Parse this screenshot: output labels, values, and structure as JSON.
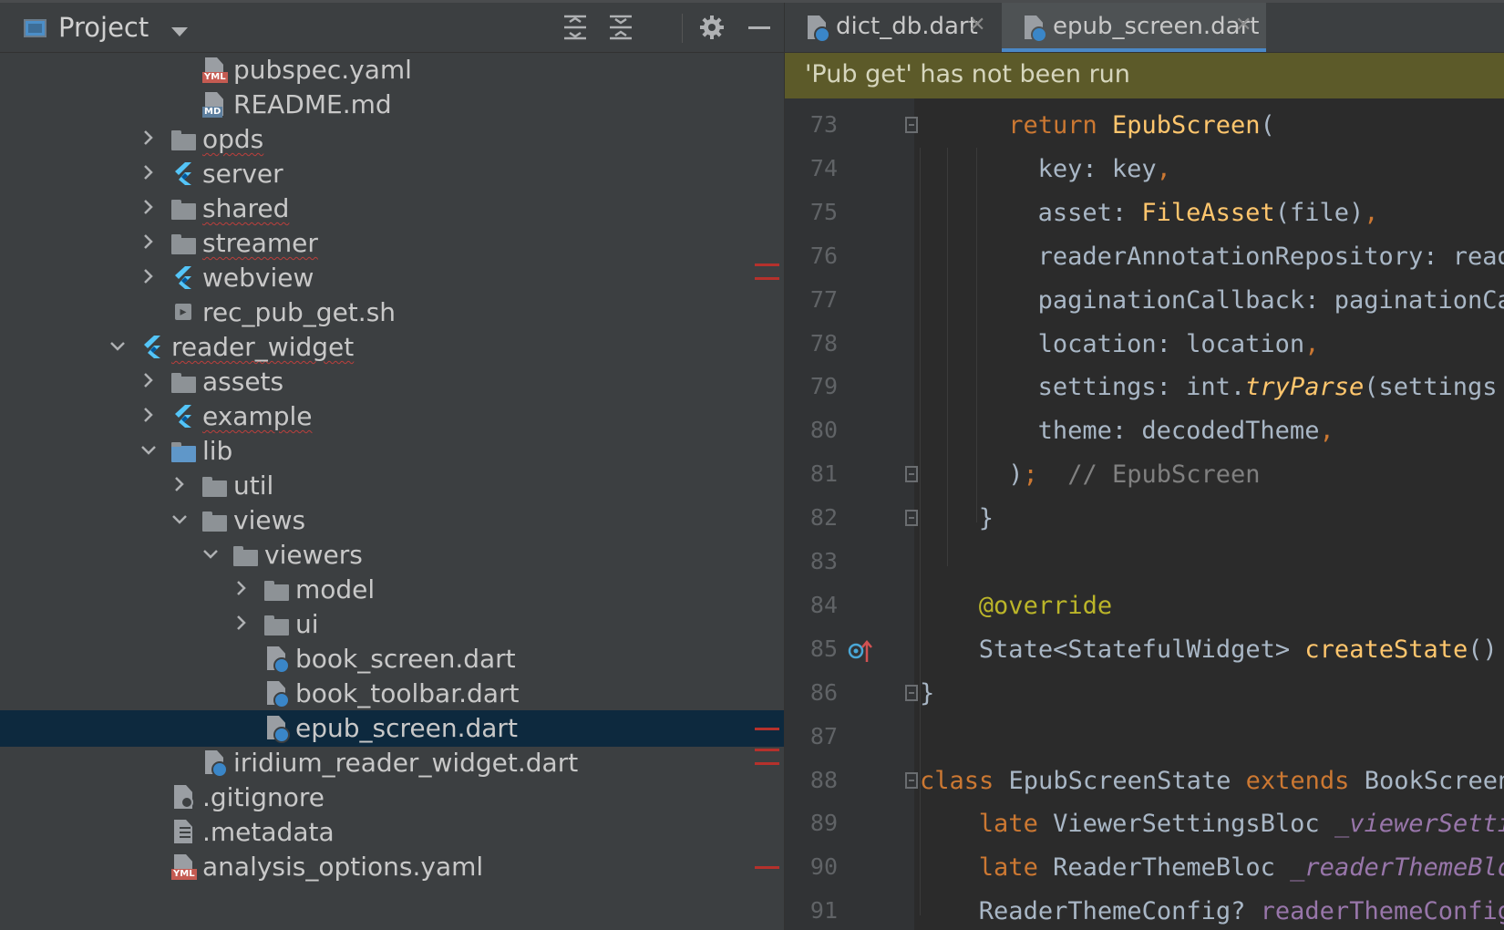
{
  "project_panel": {
    "title": "Project",
    "tree": [
      {
        "label": "pubspec.yaml",
        "icon": "yaml-file-icon",
        "depth": 6,
        "twisty": "none",
        "warn": false,
        "selected": false
      },
      {
        "label": "README.md",
        "icon": "markdown-file-icon",
        "depth": 6,
        "twisty": "none",
        "warn": false,
        "selected": false
      },
      {
        "label": "opds",
        "icon": "folder-icon",
        "depth": 5,
        "twisty": "collapsed",
        "warn": true,
        "selected": false
      },
      {
        "label": "server",
        "icon": "flutter-module-icon",
        "depth": 5,
        "twisty": "collapsed",
        "warn": false,
        "selected": false
      },
      {
        "label": "shared",
        "icon": "folder-icon",
        "depth": 5,
        "twisty": "collapsed",
        "warn": true,
        "selected": false
      },
      {
        "label": "streamer",
        "icon": "folder-icon",
        "depth": 5,
        "twisty": "collapsed",
        "warn": true,
        "selected": false
      },
      {
        "label": "webview",
        "icon": "flutter-module-icon",
        "depth": 5,
        "twisty": "collapsed",
        "warn": false,
        "selected": false
      },
      {
        "label": "rec_pub_get.sh",
        "icon": "shell-script-icon",
        "depth": 5,
        "twisty": "none",
        "warn": false,
        "selected": false
      },
      {
        "label": "reader_widget",
        "icon": "flutter-module-icon",
        "depth": 4,
        "twisty": "expanded",
        "warn": true,
        "selected": false
      },
      {
        "label": "assets",
        "icon": "folder-icon",
        "depth": 5,
        "twisty": "collapsed",
        "warn": false,
        "selected": false
      },
      {
        "label": "example",
        "icon": "flutter-module-icon",
        "depth": 5,
        "twisty": "collapsed",
        "warn": true,
        "selected": false
      },
      {
        "label": "lib",
        "icon": "source-folder-icon",
        "depth": 5,
        "twisty": "expanded",
        "warn": false,
        "selected": false
      },
      {
        "label": "util",
        "icon": "folder-icon",
        "depth": 6,
        "twisty": "collapsed",
        "warn": false,
        "selected": false
      },
      {
        "label": "views",
        "icon": "folder-icon",
        "depth": 6,
        "twisty": "expanded",
        "warn": false,
        "selected": false
      },
      {
        "label": "viewers",
        "icon": "folder-icon",
        "depth": 7,
        "twisty": "expanded",
        "warn": false,
        "selected": false
      },
      {
        "label": "model",
        "icon": "folder-icon",
        "depth": 8,
        "twisty": "collapsed",
        "warn": false,
        "selected": false
      },
      {
        "label": "ui",
        "icon": "folder-icon",
        "depth": 8,
        "twisty": "collapsed",
        "warn": false,
        "selected": false
      },
      {
        "label": "book_screen.dart",
        "icon": "dart-file-icon",
        "depth": 8,
        "twisty": "none",
        "warn": false,
        "selected": false
      },
      {
        "label": "book_toolbar.dart",
        "icon": "dart-file-icon",
        "depth": 8,
        "twisty": "none",
        "warn": false,
        "selected": false
      },
      {
        "label": "epub_screen.dart",
        "icon": "dart-file-icon",
        "depth": 8,
        "twisty": "none",
        "warn": false,
        "selected": true
      },
      {
        "label": "iridium_reader_widget.dart",
        "icon": "dart-file-icon",
        "depth": 6,
        "twisty": "none",
        "warn": false,
        "selected": false
      },
      {
        "label": ".gitignore",
        "icon": "gitignore-file-icon",
        "depth": 5,
        "twisty": "none",
        "warn": false,
        "selected": false
      },
      {
        "label": ".metadata",
        "icon": "text-file-icon",
        "depth": 5,
        "twisty": "none",
        "warn": false,
        "selected": false
      },
      {
        "label": "analysis_options.yaml",
        "icon": "yaml-file-icon",
        "depth": 5,
        "twisty": "none",
        "warn": false,
        "selected": false
      }
    ],
    "error_marker_rows": [
      6,
      19,
      20,
      23
    ]
  },
  "editor": {
    "tabs": [
      {
        "label": "dict_db.dart",
        "active": false
      },
      {
        "label": "epub_screen.dart",
        "active": true
      }
    ],
    "banner": "'Pub get' has not been run",
    "lines": [
      {
        "n": "73",
        "indent": 6,
        "fold": true,
        "html": "<span class=\"k\">return </span><span class=\"fn\">EpubScreen</span>("
      },
      {
        "n": "74",
        "indent": 8,
        "fold": false,
        "html": "key: key<span class=\"k\">,</span>"
      },
      {
        "n": "75",
        "indent": 8,
        "fold": false,
        "html": "asset: <span class=\"fn\">FileAsset</span>(file)<span class=\"k\">,</span>"
      },
      {
        "n": "76",
        "indent": 8,
        "fold": false,
        "html": "readerAnnotationRepository: readerAnnotationRepository<span class=\"k\">,</span>"
      },
      {
        "n": "77",
        "indent": 8,
        "fold": false,
        "html": "paginationCallback: paginationCallback<span class=\"k\">,</span>"
      },
      {
        "n": "78",
        "indent": 8,
        "fold": false,
        "html": "location: location<span class=\"k\">,</span>"
      },
      {
        "n": "79",
        "indent": 8,
        "fold": false,
        "html": "settings: int.<span class=\"it\">tryParse</span>(settings ?? ''<span class=\"k\">)</span>"
      },
      {
        "n": "80",
        "indent": 8,
        "fold": false,
        "html": "theme: decodedTheme<span class=\"k\">,</span>"
      },
      {
        "n": "81",
        "indent": 6,
        "fold": true,
        "html": ")<span class=\"k\">;</span>  <span class=\"cm\">// EpubScreen</span>"
      },
      {
        "n": "82",
        "indent": 4,
        "fold": true,
        "html": "}"
      },
      {
        "n": "83",
        "indent": 0,
        "fold": false,
        "html": ""
      },
      {
        "n": "84",
        "indent": 4,
        "fold": false,
        "html": "<span class=\"an\">@override</span>"
      },
      {
        "n": "85",
        "indent": 4,
        "fold": false,
        "override": true,
        "html": "State&lt;StatefulWidget&gt; <span class=\"fn\">createState</span>() =&gt; EpubScreenState()<span class=\"k\">;</span>"
      },
      {
        "n": "86",
        "indent": 0,
        "fold": true,
        "html": "}"
      },
      {
        "n": "87",
        "indent": 0,
        "fold": false,
        "html": ""
      },
      {
        "n": "88",
        "indent": 0,
        "fold": true,
        "html": "<span class=\"k\">class </span>EpubScreenState <span class=\"k\">extends </span>BookScreenState&lt;EpubScreen&gt; {"
      },
      {
        "n": "89",
        "indent": 4,
        "fold": false,
        "html": "<span class=\"k\">late </span>ViewerSettingsBloc <span class=\"fldi\">_viewerSettingsBloc</span><span class=\"k\">;</span>"
      },
      {
        "n": "90",
        "indent": 4,
        "fold": false,
        "html": "<span class=\"k\">late </span>ReaderThemeBloc <span class=\"fldi\">_readerThemeBloc</span><span class=\"k\">;</span>"
      },
      {
        "n": "91",
        "indent": 4,
        "fold": false,
        "html": "ReaderThemeConfig? <span class=\"fld\">readerThemeConfig</span><span class=\"k\">;</span>"
      }
    ]
  },
  "colors": {
    "panel_bg": "#3c3f41",
    "editor_bg": "#2b2b2b",
    "selection": "#0d293e",
    "banner_bg": "#5c5a29",
    "tab_underline": "#4a88c7",
    "error_marker": "#b5312c"
  }
}
